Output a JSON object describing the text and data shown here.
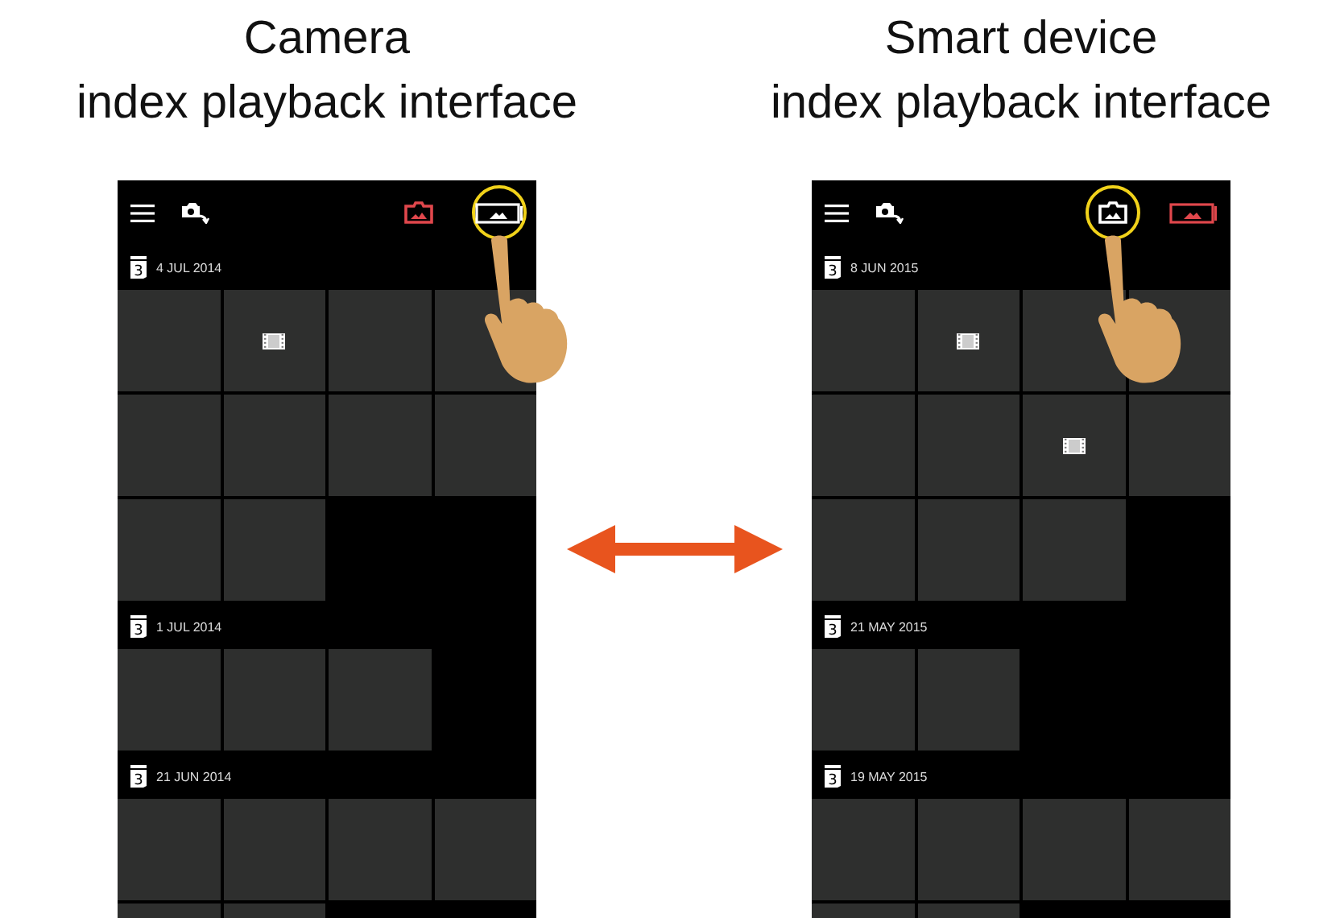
{
  "panels": [
    {
      "title_lines": [
        "Camera",
        "index playback interface"
      ],
      "tabs": [
        {
          "kind": "camera",
          "selected": true,
          "tapped": false
        },
        {
          "kind": "device",
          "selected": false,
          "tapped": true
        }
      ],
      "groups": [
        {
          "date": "4 JUL 2014",
          "icon_day": "3",
          "tiles": [
            {
              "kind": "photo"
            },
            {
              "kind": "video"
            },
            {
              "kind": "photo"
            },
            {
              "kind": "photo"
            },
            {
              "kind": "photo"
            },
            {
              "kind": "photo"
            },
            {
              "kind": "photo"
            },
            {
              "kind": "photo"
            },
            {
              "kind": "photo"
            },
            {
              "kind": "photo"
            }
          ]
        },
        {
          "date": "1 JUL 2014",
          "icon_day": "3",
          "tiles": [
            {
              "kind": "photo"
            },
            {
              "kind": "photo"
            },
            {
              "kind": "photo"
            }
          ]
        },
        {
          "date": "21 JUN 2014",
          "icon_day": "3",
          "tiles": [
            {
              "kind": "photo"
            },
            {
              "kind": "photo"
            },
            {
              "kind": "photo"
            },
            {
              "kind": "photo"
            },
            {
              "kind": "photo"
            },
            {
              "kind": "photo"
            }
          ]
        }
      ]
    },
    {
      "title_lines": [
        "Smart device",
        "index playback interface"
      ],
      "tabs": [
        {
          "kind": "camera",
          "selected": false,
          "tapped": true
        },
        {
          "kind": "device",
          "selected": true,
          "tapped": false
        }
      ],
      "groups": [
        {
          "date": "8 JUN 2015",
          "icon_day": "3",
          "tiles": [
            {
              "kind": "photo"
            },
            {
              "kind": "video"
            },
            {
              "kind": "photo"
            },
            {
              "kind": "photo"
            },
            {
              "kind": "photo"
            },
            {
              "kind": "photo"
            },
            {
              "kind": "video"
            },
            {
              "kind": "photo"
            },
            {
              "kind": "photo"
            },
            {
              "kind": "photo"
            },
            {
              "kind": "photo"
            }
          ]
        },
        {
          "date": "21 MAY 2015",
          "icon_day": "3",
          "tiles": [
            {
              "kind": "photo"
            },
            {
              "kind": "photo"
            }
          ]
        },
        {
          "date": "19 MAY 2015",
          "icon_day": "3",
          "tiles": [
            {
              "kind": "photo"
            },
            {
              "kind": "photo"
            },
            {
              "kind": "photo"
            },
            {
              "kind": "photo"
            },
            {
              "kind": "photo"
            },
            {
              "kind": "photo"
            }
          ]
        }
      ]
    }
  ]
}
